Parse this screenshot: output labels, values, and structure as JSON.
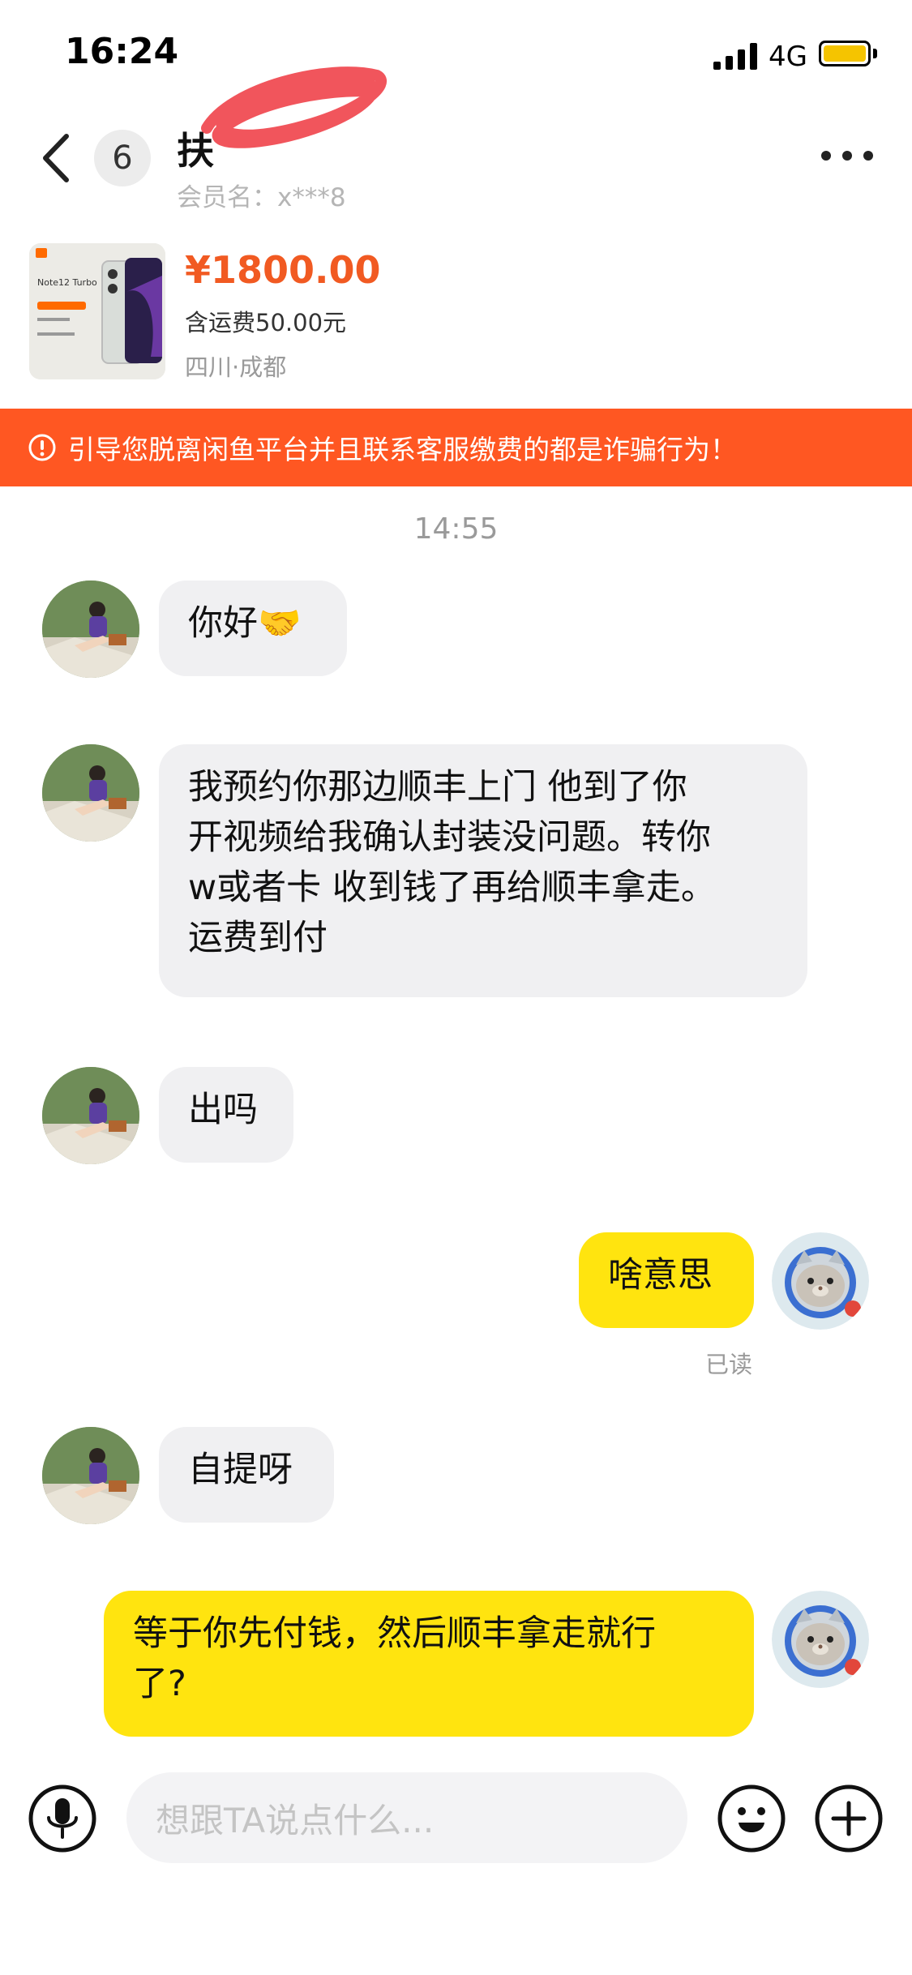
{
  "status_bar": {
    "time": "16:24",
    "network": "4G"
  },
  "header": {
    "unread_count": "6",
    "title": "扶",
    "member_label": "会员名：x***8"
  },
  "product": {
    "price": "¥1800.00",
    "shipping": "含运费50.00元",
    "location": "四川·成都",
    "thumb_text": "Note12 Turbo"
  },
  "warning": {
    "text": "引导您脱离闲鱼平台并且联系客服缴费的都是诈骗行为！"
  },
  "chat": {
    "timestamp": "14:55",
    "messages": [
      {
        "side": "left",
        "text": "你好🤝"
      },
      {
        "side": "left",
        "lines": [
          "我预约你那边顺丰上门 他到了你",
          "开视频给我确认封装没问题。转你",
          "w或者卡 收到钱了再给顺丰拿走。",
          "运费到付"
        ]
      },
      {
        "side": "left",
        "text": "出吗"
      },
      {
        "side": "right",
        "text": "啥意思",
        "status": "已读"
      },
      {
        "side": "left",
        "text": "自提呀"
      },
      {
        "side": "right",
        "lines": [
          "等于你先付钱，然后顺丰拿走就行",
          "了?"
        ]
      }
    ]
  },
  "input_bar": {
    "placeholder": "想跟TA说点什么..."
  },
  "colors": {
    "accent_orange": "#f15a22",
    "warning_bg": "#ff5722",
    "my_bubble": "#ffe40f",
    "their_bubble": "#f0f0f2"
  }
}
